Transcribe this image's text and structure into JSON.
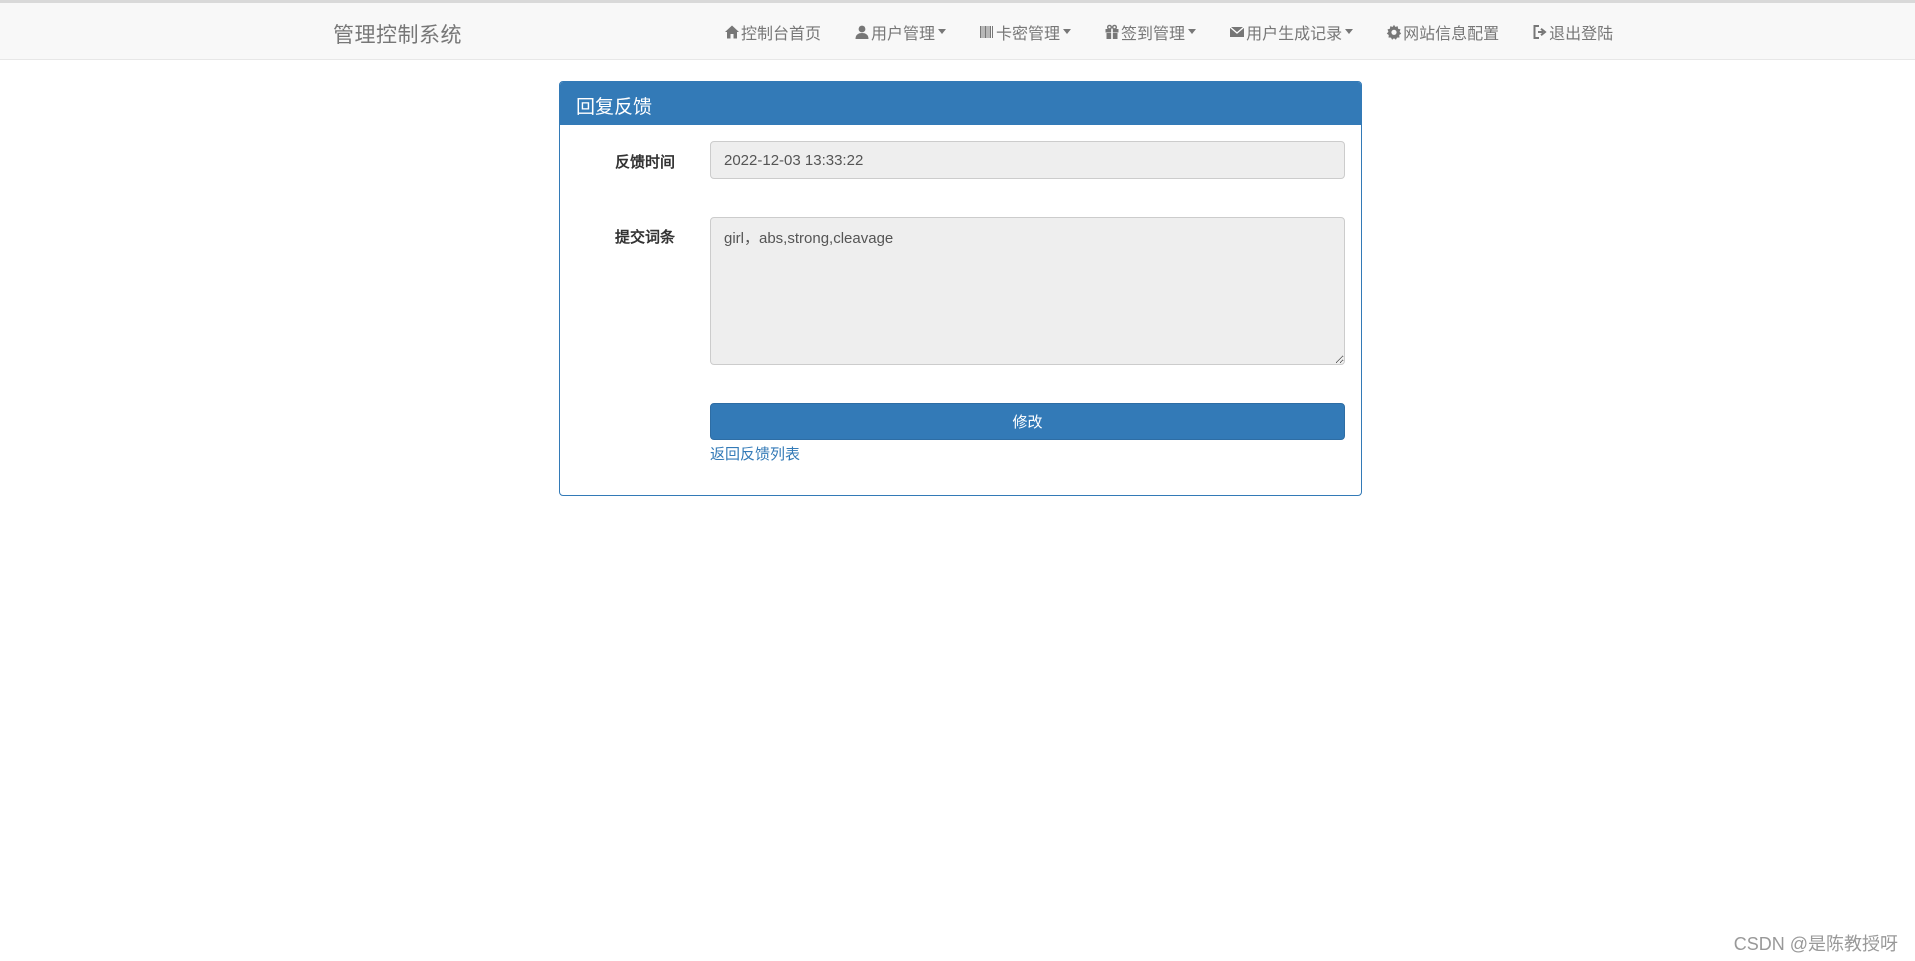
{
  "navbar": {
    "brand": "管理控制系统",
    "items": [
      {
        "label": "控制台首页",
        "icon": "home-icon",
        "dropdown": false
      },
      {
        "label": "用户管理",
        "icon": "user-icon",
        "dropdown": true
      },
      {
        "label": "卡密管理",
        "icon": "barcode-icon",
        "dropdown": true
      },
      {
        "label": "签到管理",
        "icon": "gift-icon",
        "dropdown": true
      },
      {
        "label": "用户生成记录",
        "icon": "envelope-icon",
        "dropdown": true
      },
      {
        "label": "网站信息配置",
        "icon": "gear-icon",
        "dropdown": false
      },
      {
        "label": "退出登陆",
        "icon": "logout-icon",
        "dropdown": false
      }
    ]
  },
  "panel": {
    "title": "回复反馈",
    "fields": {
      "time_label": "反馈时间",
      "time_value": "2022-12-03 13:33:22",
      "words_label": "提交词条",
      "words_value": "girl，abs,strong,cleavage"
    },
    "submit_label": "修改",
    "back_link": "返回反馈列表"
  },
  "watermark": "CSDN @是陈教授呀",
  "colors": {
    "primary": "#337ab7",
    "navbar_bg": "#f8f8f8",
    "nav_text": "#777777",
    "input_bg": "#eeeeee"
  }
}
